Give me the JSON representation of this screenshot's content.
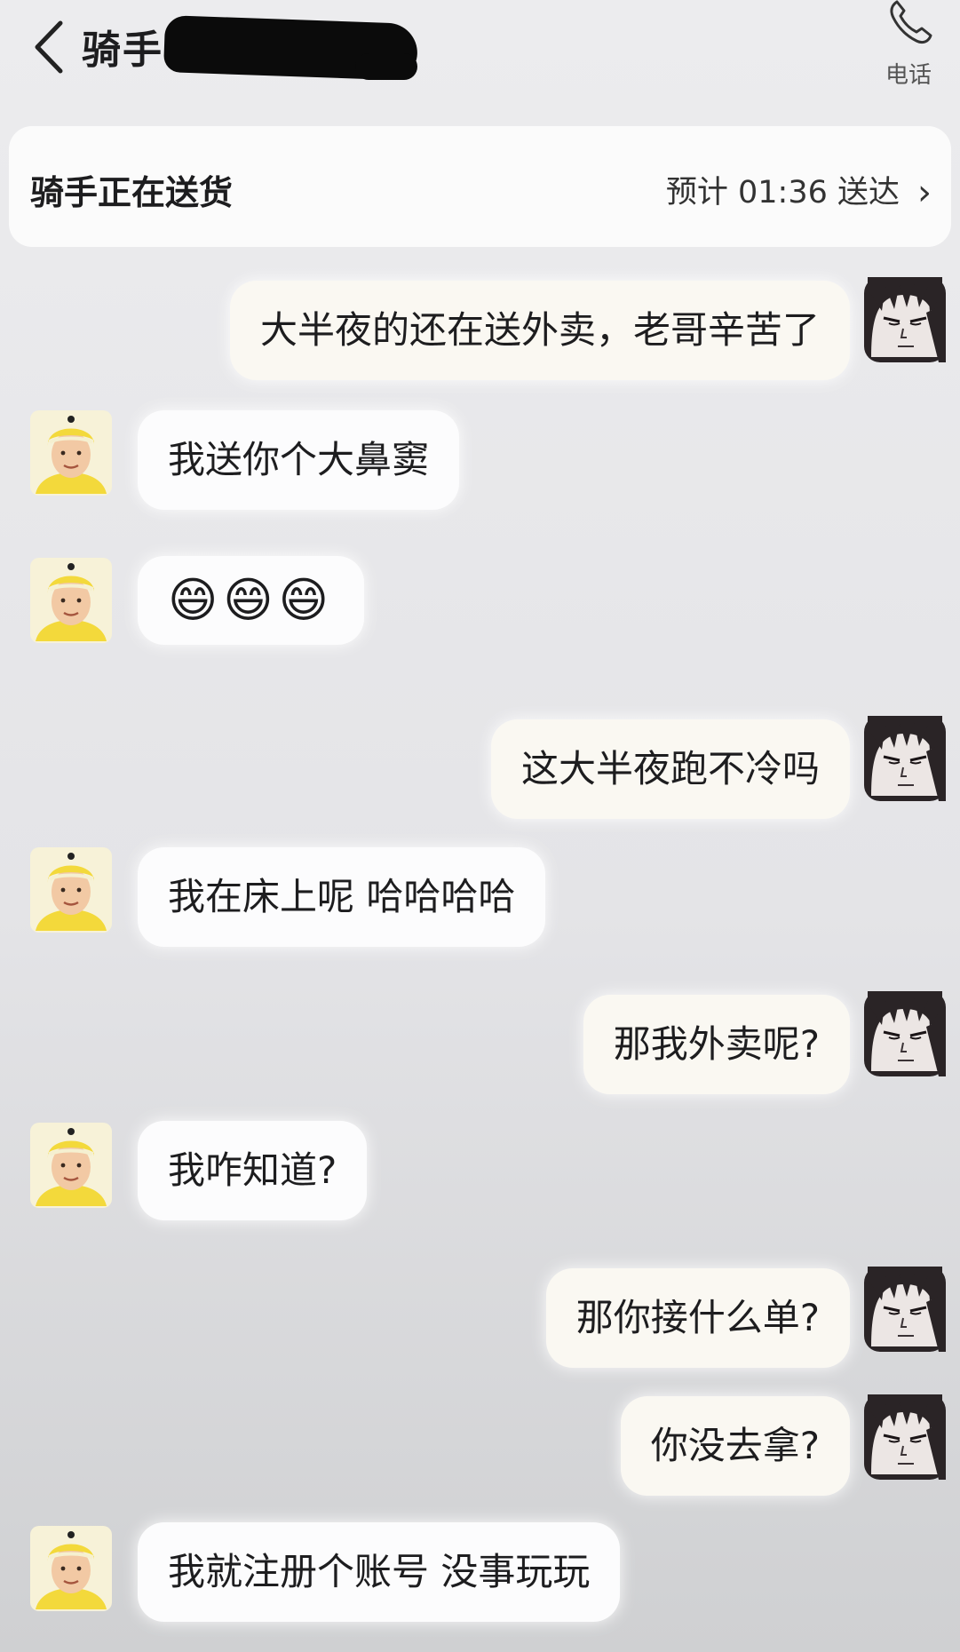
{
  "header": {
    "title": "骑手",
    "call_label": "电话",
    "back_icon": "chevron-left-icon",
    "call_icon": "phone-icon"
  },
  "status": {
    "text": "骑手正在送货",
    "eta": "预计 01:36 送达",
    "eta_icon": "chevron-right-icon"
  },
  "messages": [
    {
      "from": "me",
      "text": "大半夜的还在送外卖，老哥辛苦了"
    },
    {
      "from": "rider",
      "text": "我送你个大鼻窦"
    },
    {
      "from": "rider",
      "text": "😄😄😄"
    },
    {
      "from": "me",
      "text": "这大半夜跑不冷吗"
    },
    {
      "from": "rider",
      "text": "我在床上呢 哈哈哈哈"
    },
    {
      "from": "me",
      "text": "那我外卖呢?"
    },
    {
      "from": "rider",
      "text": "我咋知道?"
    },
    {
      "from": "me",
      "text": "那你接什么单?"
    },
    {
      "from": "me",
      "text": "你没去拿?"
    },
    {
      "from": "rider",
      "text": "我就注册个账号 没事玩玩"
    }
  ],
  "colors": {
    "rider_helmet": "#f3d93b",
    "me_avatar_dark": "#2a2426"
  }
}
